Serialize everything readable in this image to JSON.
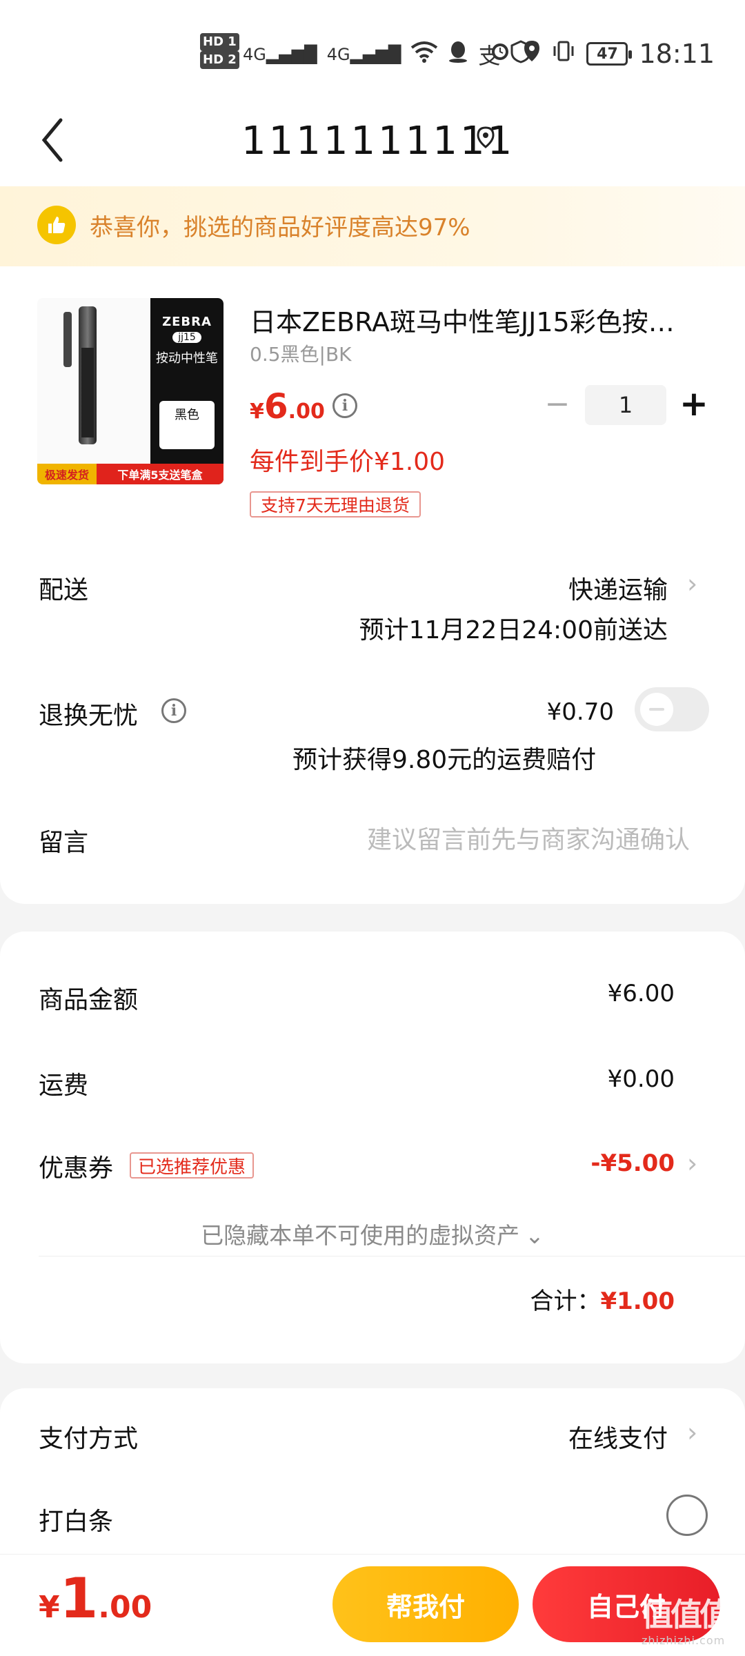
{
  "status_bar": {
    "sim1": "HD 1",
    "sim2": "HD 2",
    "network1": "4G",
    "network2": "4G",
    "battery": "47",
    "time": "18:11"
  },
  "header": {
    "title": "1111111111"
  },
  "banner": {
    "text": "恭喜你，挑选的商品好评度高达97%"
  },
  "product": {
    "image": {
      "brand": "ZEBRA",
      "model": "jj15",
      "kind": "按动中性笔",
      "color": "黑色",
      "tag_left": "极速发货",
      "tag_right": "下单满5支送笔盒"
    },
    "title": "日本ZEBRA斑马中性笔JJ15彩色按…",
    "spec": "0.5黑色|BK",
    "price_currency": "¥",
    "price_int": "6",
    "price_dec": ".00",
    "quantity": "1",
    "unit_price": "每件到手价¥1.00",
    "return_tag": "支持7天无理由退货"
  },
  "shipping": {
    "label": "配送",
    "method": "快递运输",
    "eta": "预计11月22日24:00前送达"
  },
  "return_insurance": {
    "label": "退换无忧",
    "price": "¥0.70",
    "note": "预计获得9.80元的运费赔付",
    "enabled": false
  },
  "message": {
    "label": "留言",
    "placeholder": "建议留言前先与商家沟通确认"
  },
  "summary": {
    "goods_label": "商品金额",
    "goods_value": "¥6.00",
    "shipping_label": "运费",
    "shipping_value": "¥0.00",
    "coupon_label": "优惠券",
    "coupon_tag": "已选推荐优惠",
    "coupon_value": "-¥5.00",
    "hidden_assets": "已隐藏本单不可使用的虚拟资产",
    "total_label": "合计：",
    "total_value": "¥1.00"
  },
  "payment": {
    "method_label": "支付方式",
    "method_value": "在线支付",
    "iou_label": "打白条"
  },
  "bottom": {
    "price_currency": "¥",
    "price_int": "1",
    "price_dec": ".00",
    "help_pay": "帮我付",
    "self_pay": "自己付",
    "watermark": "值值值",
    "watermark_sub": "zhizhizhi.com"
  },
  "colors": {
    "accent_red": "#e32a1b",
    "accent_yellow": "#ffb000",
    "banner_text": "#d9822b"
  }
}
